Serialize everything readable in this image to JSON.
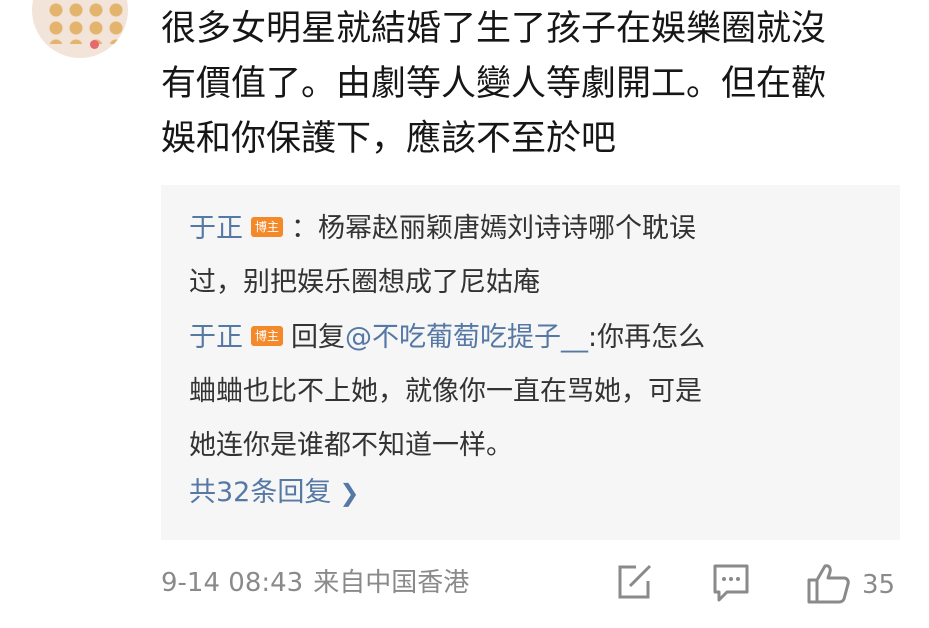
{
  "comment": {
    "lines": [
      "很多女明星就結婚了生了孩子在娛樂圈就沒",
      "有價值了。由劇等人變人等劇開工。但在歡",
      "娛和你保護下，應該不至於吧"
    ]
  },
  "replies": [
    {
      "author": "于正",
      "badge": "博主",
      "text_lines": [
        "：杨幂赵丽颖唐嫣刘诗诗哪个耽误",
        "过，别把娱乐圈想成了尼姑庵"
      ]
    },
    {
      "author": "于正",
      "badge": "博主",
      "reply_prefix": "回复",
      "mention": "@不吃葡萄吃提子__",
      "text_lines": [
        ":你再怎么",
        "蛐蛐也比不上她，就像你一直在骂她，可是",
        "她连你是谁都不知道一样。"
      ]
    }
  ],
  "more_replies": {
    "label": "共32条回复",
    "icon": "chevron-right-icon"
  },
  "footer": {
    "timestamp": "9-14 08:43",
    "source": "来自中国香港",
    "like_count": "35",
    "icons": [
      "share-icon",
      "comment-icon",
      "like-icon"
    ]
  },
  "colors": {
    "link": "#5578a5",
    "badge": "#f4892a",
    "reply_bg": "#f6f6f6",
    "meta": "#8a8a8a"
  }
}
